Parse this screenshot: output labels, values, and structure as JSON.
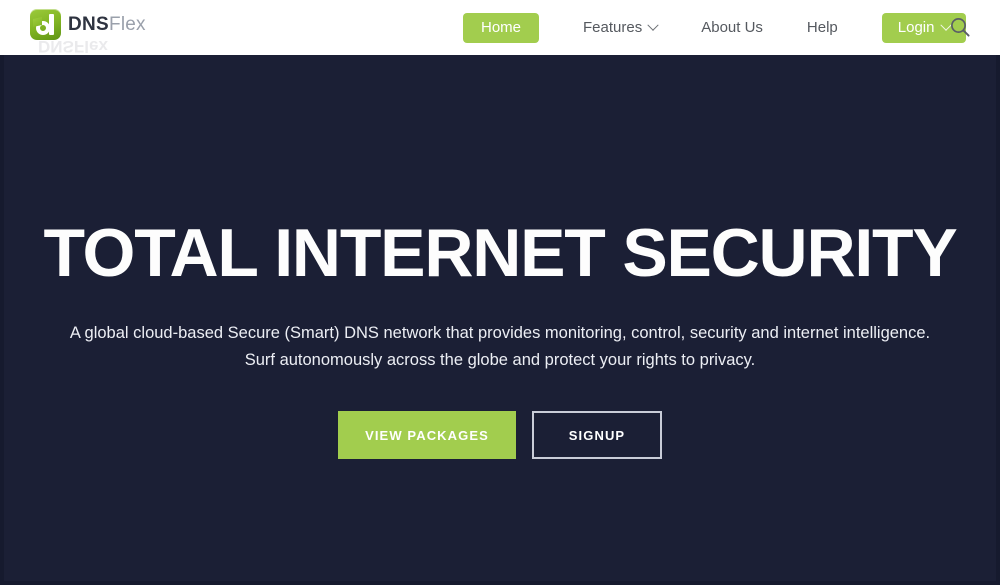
{
  "brand": {
    "mark_icon": "dnsflex-logo-icon",
    "name_bold": "DNS",
    "name_light": "Flex",
    "reflection_text": "DNSFlex"
  },
  "nav": {
    "items": [
      {
        "label": "Home",
        "style": "pill",
        "has_caret": false,
        "active": true
      },
      {
        "label": "Features",
        "style": "link",
        "has_caret": true,
        "active": false
      },
      {
        "label": "About Us",
        "style": "link",
        "has_caret": false,
        "active": false
      },
      {
        "label": "Help",
        "style": "link",
        "has_caret": false,
        "active": false
      },
      {
        "label": "Login",
        "style": "pill",
        "has_caret": true,
        "active": false
      }
    ],
    "search_icon": "search-icon"
  },
  "hero": {
    "title": "TOTAL INTERNET SECURITY",
    "subtitle_line1": "A global cloud-based Secure (Smart) DNS network that provides monitoring, control, security and internet intelligence.",
    "subtitle_line2": "Surf autonomously across the globe and protect your rights to privacy.",
    "primary_button": "VIEW PACKAGES",
    "secondary_button": "SIGNUP"
  },
  "colors": {
    "brand_green": "#a2cd4e",
    "hero_background": "#1b1f35",
    "header_background": "#ffffff",
    "nav_link": "#55595f",
    "hero_text": "#ffffff",
    "outline_border": "#c9ccd8"
  }
}
